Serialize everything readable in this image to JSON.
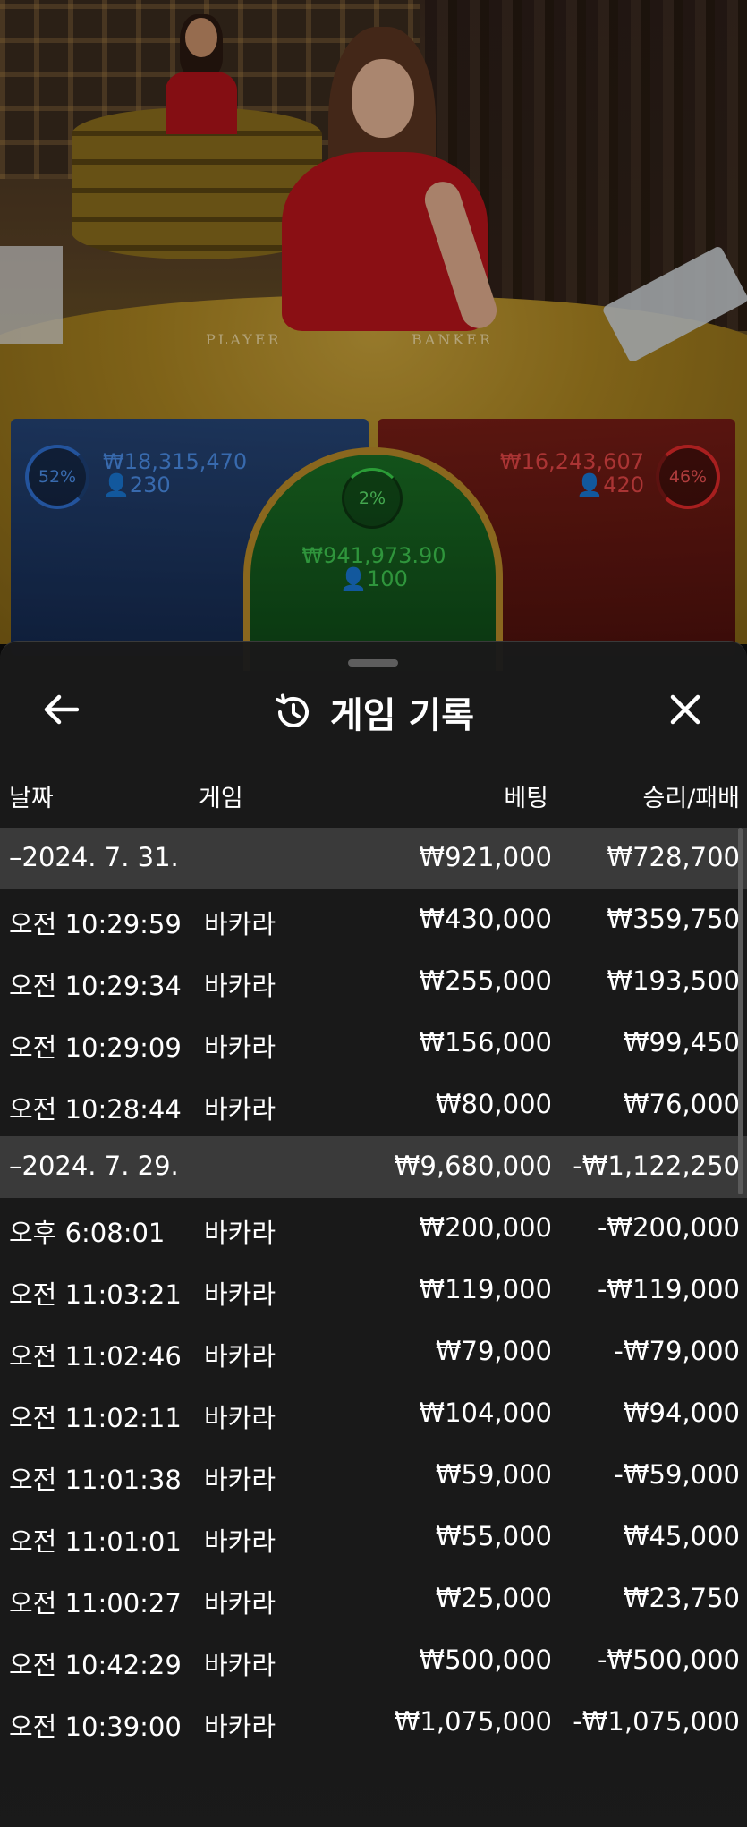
{
  "video": {
    "felt_player_label": "PLAYER",
    "felt_banker_label": "BANKER"
  },
  "bet_spots": {
    "player": {
      "percent": "52%",
      "amount": "₩18,315,470",
      "players": "230"
    },
    "tie": {
      "percent": "2%",
      "amount": "₩941,973.90",
      "players": "100"
    },
    "banker": {
      "percent": "46%",
      "amount": "₩16,243,607",
      "players": "420"
    }
  },
  "sheet": {
    "title": "게임 기록",
    "back_icon": "arrow-left-icon",
    "history_icon": "history-clock-icon",
    "close_icon": "close-icon",
    "columns": {
      "date": "날짜",
      "game": "게임",
      "bet": "베팅",
      "result": "승리/패배"
    },
    "groups": [
      {
        "date": "–2024. 7. 31.",
        "bet_total": "₩921,000",
        "result_total": "₩728,700",
        "rows": [
          {
            "time": "오전 10:29:59",
            "game": "바카라",
            "bet": "₩430,000",
            "result": "₩359,750"
          },
          {
            "time": "오전 10:29:34",
            "game": "바카라",
            "bet": "₩255,000",
            "result": "₩193,500"
          },
          {
            "time": "오전 10:29:09",
            "game": "바카라",
            "bet": "₩156,000",
            "result": "₩99,450"
          },
          {
            "time": "오전 10:28:44",
            "game": "바카라",
            "bet": "₩80,000",
            "result": "₩76,000"
          }
        ]
      },
      {
        "date": "–2024. 7. 29.",
        "bet_total": "₩9,680,000",
        "result_total": "-₩1,122,250",
        "rows": [
          {
            "time": "오후 6:08:01",
            "game": "바카라",
            "bet": "₩200,000",
            "result": "-₩200,000"
          },
          {
            "time": "오전 11:03:21",
            "game": "바카라",
            "bet": "₩119,000",
            "result": "-₩119,000"
          },
          {
            "time": "오전 11:02:46",
            "game": "바카라",
            "bet": "₩79,000",
            "result": "-₩79,000"
          },
          {
            "time": "오전 11:02:11",
            "game": "바카라",
            "bet": "₩104,000",
            "result": "₩94,000"
          },
          {
            "time": "오전 11:01:38",
            "game": "바카라",
            "bet": "₩59,000",
            "result": "-₩59,000"
          },
          {
            "time": "오전 11:01:01",
            "game": "바카라",
            "bet": "₩55,000",
            "result": "₩45,000"
          },
          {
            "time": "오전 11:00:27",
            "game": "바카라",
            "bet": "₩25,000",
            "result": "₩23,750"
          },
          {
            "time": "오전 10:42:29",
            "game": "바카라",
            "bet": "₩500,000",
            "result": "-₩500,000"
          },
          {
            "time": "오전 10:39:00",
            "game": "바카라",
            "bet": "₩1,075,000",
            "result": "-₩1,075,000"
          }
        ]
      }
    ]
  },
  "colors": {
    "player_blue": "#4b8ee8",
    "banker_red": "#e34646",
    "tie_green": "#3fc750",
    "sheet_bg": "#1a1a1a",
    "date_row_bg": "#3a3a3a"
  }
}
